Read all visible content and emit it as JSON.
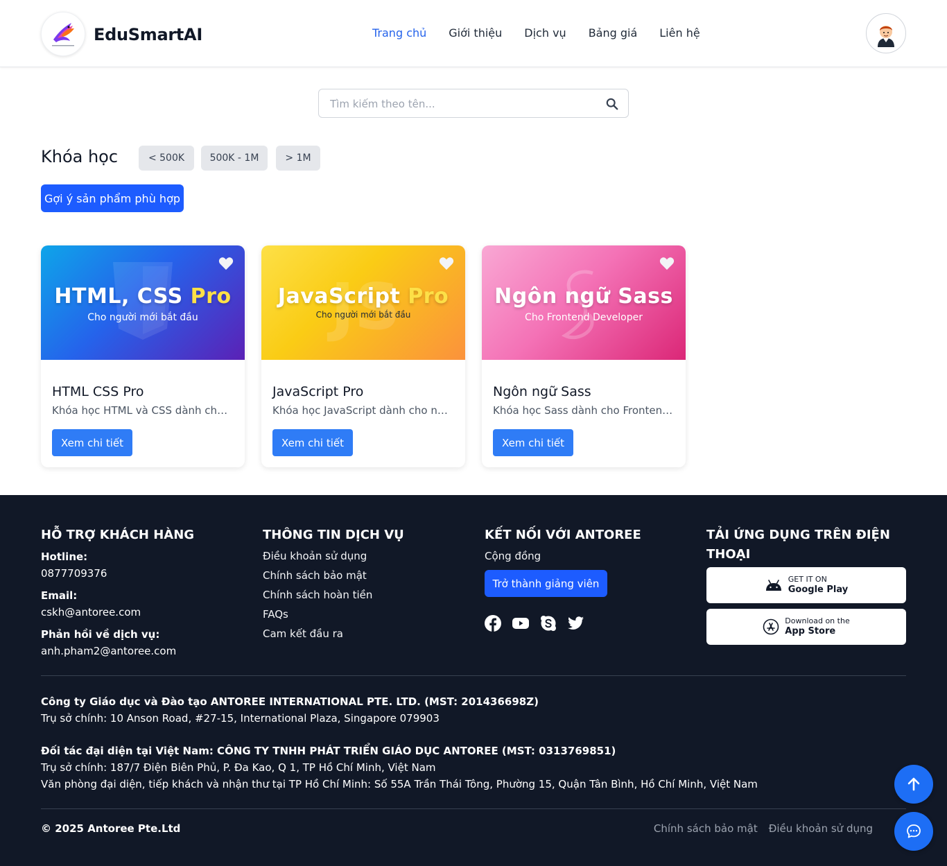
{
  "header": {
    "brand": "EduSmartAI",
    "nav": [
      "Trang chủ",
      "Giới thiệu",
      "Dịch vụ",
      "Bảng giá",
      "Liên hệ"
    ],
    "active_nav": "Trang chủ"
  },
  "search": {
    "placeholder": "Tìm kiếm theo tên...",
    "value": ""
  },
  "courses": {
    "title": "Khóa học",
    "filters": [
      "< 500K",
      "500K - 1M",
      "> 1M"
    ],
    "suggest_button": "Gợi ý sản phẩm phù hợp",
    "items": [
      {
        "banner_title": "HTML, CSS Pro",
        "banner_subtitle": "Cho người mới bắt đầu",
        "title": "HTML CSS Pro",
        "description": "Khóa học HTML và CSS dành cho người mới bắt đầu",
        "button": "Xem chi tiết",
        "gradient": [
          "#0ea5e9",
          "#5b21b6"
        ]
      },
      {
        "banner_title": "JavaScript Pro",
        "banner_subtitle": "Cho người mới bắt đầu",
        "title": "JavaScript Pro",
        "description": "Khóa học JavaScript dành cho người mới bắt đầu",
        "button": "Xem chi tiết",
        "gradient": [
          "#facc15",
          "#f97316"
        ]
      },
      {
        "banner_title": "Ngôn ngữ Sass",
        "banner_subtitle": "Cho Frontend Developer",
        "title": "Ngôn ngữ Sass",
        "description": "Khóa học Sass dành cho Frontend Developer",
        "button": "Xem chi tiết",
        "gradient": [
          "#f472b6",
          "#db2777"
        ]
      }
    ]
  },
  "footer": {
    "support": {
      "heading": "HỖ TRỢ KHÁCH HÀNG",
      "hotline_label": "Hotline:",
      "hotline": "0877709376",
      "email_label": "Email:",
      "email": "cskh@antoree.com",
      "feedback_label": "Phản hồi về dịch vụ:",
      "feedback_email": "anh.pham2@antoree.com"
    },
    "service": {
      "heading": "THÔNG TIN DỊCH VỤ",
      "links": [
        "Điều khoản sử dụng",
        "Chính sách bảo mật",
        "Chính sách hoàn tiền",
        "FAQs",
        "Cam kết đầu ra"
      ]
    },
    "connect": {
      "heading": "KẾT NỐI VỚI ANTOREE",
      "community": "Cộng đồng",
      "teacher_button": "Trở thành giảng viên",
      "social": [
        "facebook-icon",
        "youtube-icon",
        "skype-icon",
        "twitter-icon"
      ]
    },
    "apps": {
      "heading": "TẢI ỨNG DỤNG TRÊN ĐIỆN THOẠI",
      "google_small": "GET IT ON",
      "google_big": "Google Play",
      "apple_small": "Download on the",
      "apple_big": "App Store"
    },
    "company": {
      "line1": "Công ty Giáo dục và Đào tạo ANTOREE INTERNATIONAL PTE. LTD. (MST: 201436698Z)",
      "line2": "Trụ sở chính: 10 Anson Road, #27-15, International Plaza, Singapore 079903",
      "line3": "Đối tác đại diện tại Việt Nam: CÔNG TY TNHH PHÁT TRIỂN GIÁO DỤC ANTOREE (MST: 0313769851)",
      "line4": "Trụ sở chính: 187/7 Điện Biên Phủ, P. Đa Kao, Q 1, TP Hồ Chí Minh, Việt Nam",
      "line5": "Văn phòng đại diện, tiếp khách và nhận thư tại TP Hồ Chí Minh: Số 55A Trần Thái Tông, Phường 15, Quận Tân Bình, Hồ Chí Minh, Việt Nam"
    },
    "copyright": "© 2025 Antoree Pte.Ltd",
    "bottom_links": [
      "Chính sách bảo mật",
      "Điều khoản sử dụng"
    ]
  },
  "colors": {
    "accent": "#2563eb",
    "button": "#1d5cff",
    "footer_bg": "#111827"
  }
}
